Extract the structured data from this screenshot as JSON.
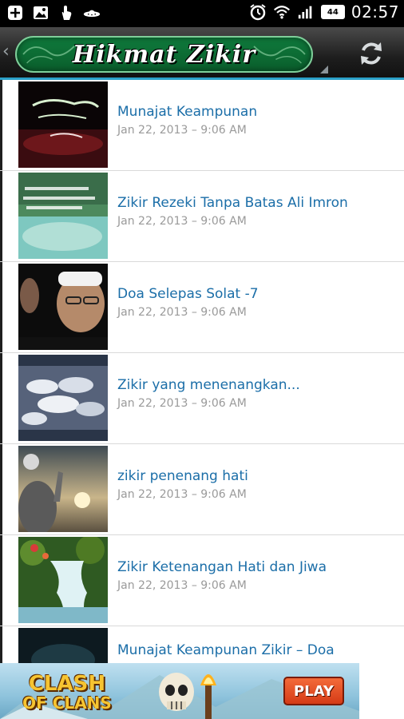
{
  "status_bar": {
    "time": "02:57",
    "battery_level": "44",
    "left_icons": [
      "add-box-icon",
      "image-icon",
      "touch-hand-icon",
      "ufo-icon"
    ],
    "right_icons": [
      "alarm-icon",
      "wifi-icon",
      "signal-icon"
    ]
  },
  "app_bar": {
    "title": "Hikmat Zikir",
    "back_glyph": "‹",
    "refresh_icon": "refresh-icon",
    "accent_color": "#2aa0c8",
    "title_bg_color": "#0f7a3c"
  },
  "articles": [
    {
      "title": "Munajat Keampunan",
      "date": "Jan 22, 2013 – 9:06 AM"
    },
    {
      "title": "Zikir Rezeki Tanpa Batas Ali Imron",
      "date": "Jan 22, 2013 – 9:06 AM"
    },
    {
      "title": "Doa Selepas Solat -7",
      "date": "Jan 22, 2013 – 9:06 AM"
    },
    {
      "title": "Zikir yang menenangkan...",
      "date": "Jan 22, 2013 – 9:06 AM"
    },
    {
      "title": "zikir penenang hati",
      "date": "Jan 22, 2013 – 9:06 AM"
    },
    {
      "title": "Zikir Ketenangan Hati dan Jiwa",
      "date": "Jan 22, 2013 – 9:06 AM"
    },
    {
      "title": "Munajat Keampunan Zikir – Doa",
      "date": ""
    }
  ],
  "ad": {
    "logo_line1": "CLASH",
    "logo_line2": "OF CLANS",
    "play_label": "PLAY"
  },
  "colors": {
    "title_link": "#1b6ea8",
    "date_text": "#9a9a9a"
  }
}
